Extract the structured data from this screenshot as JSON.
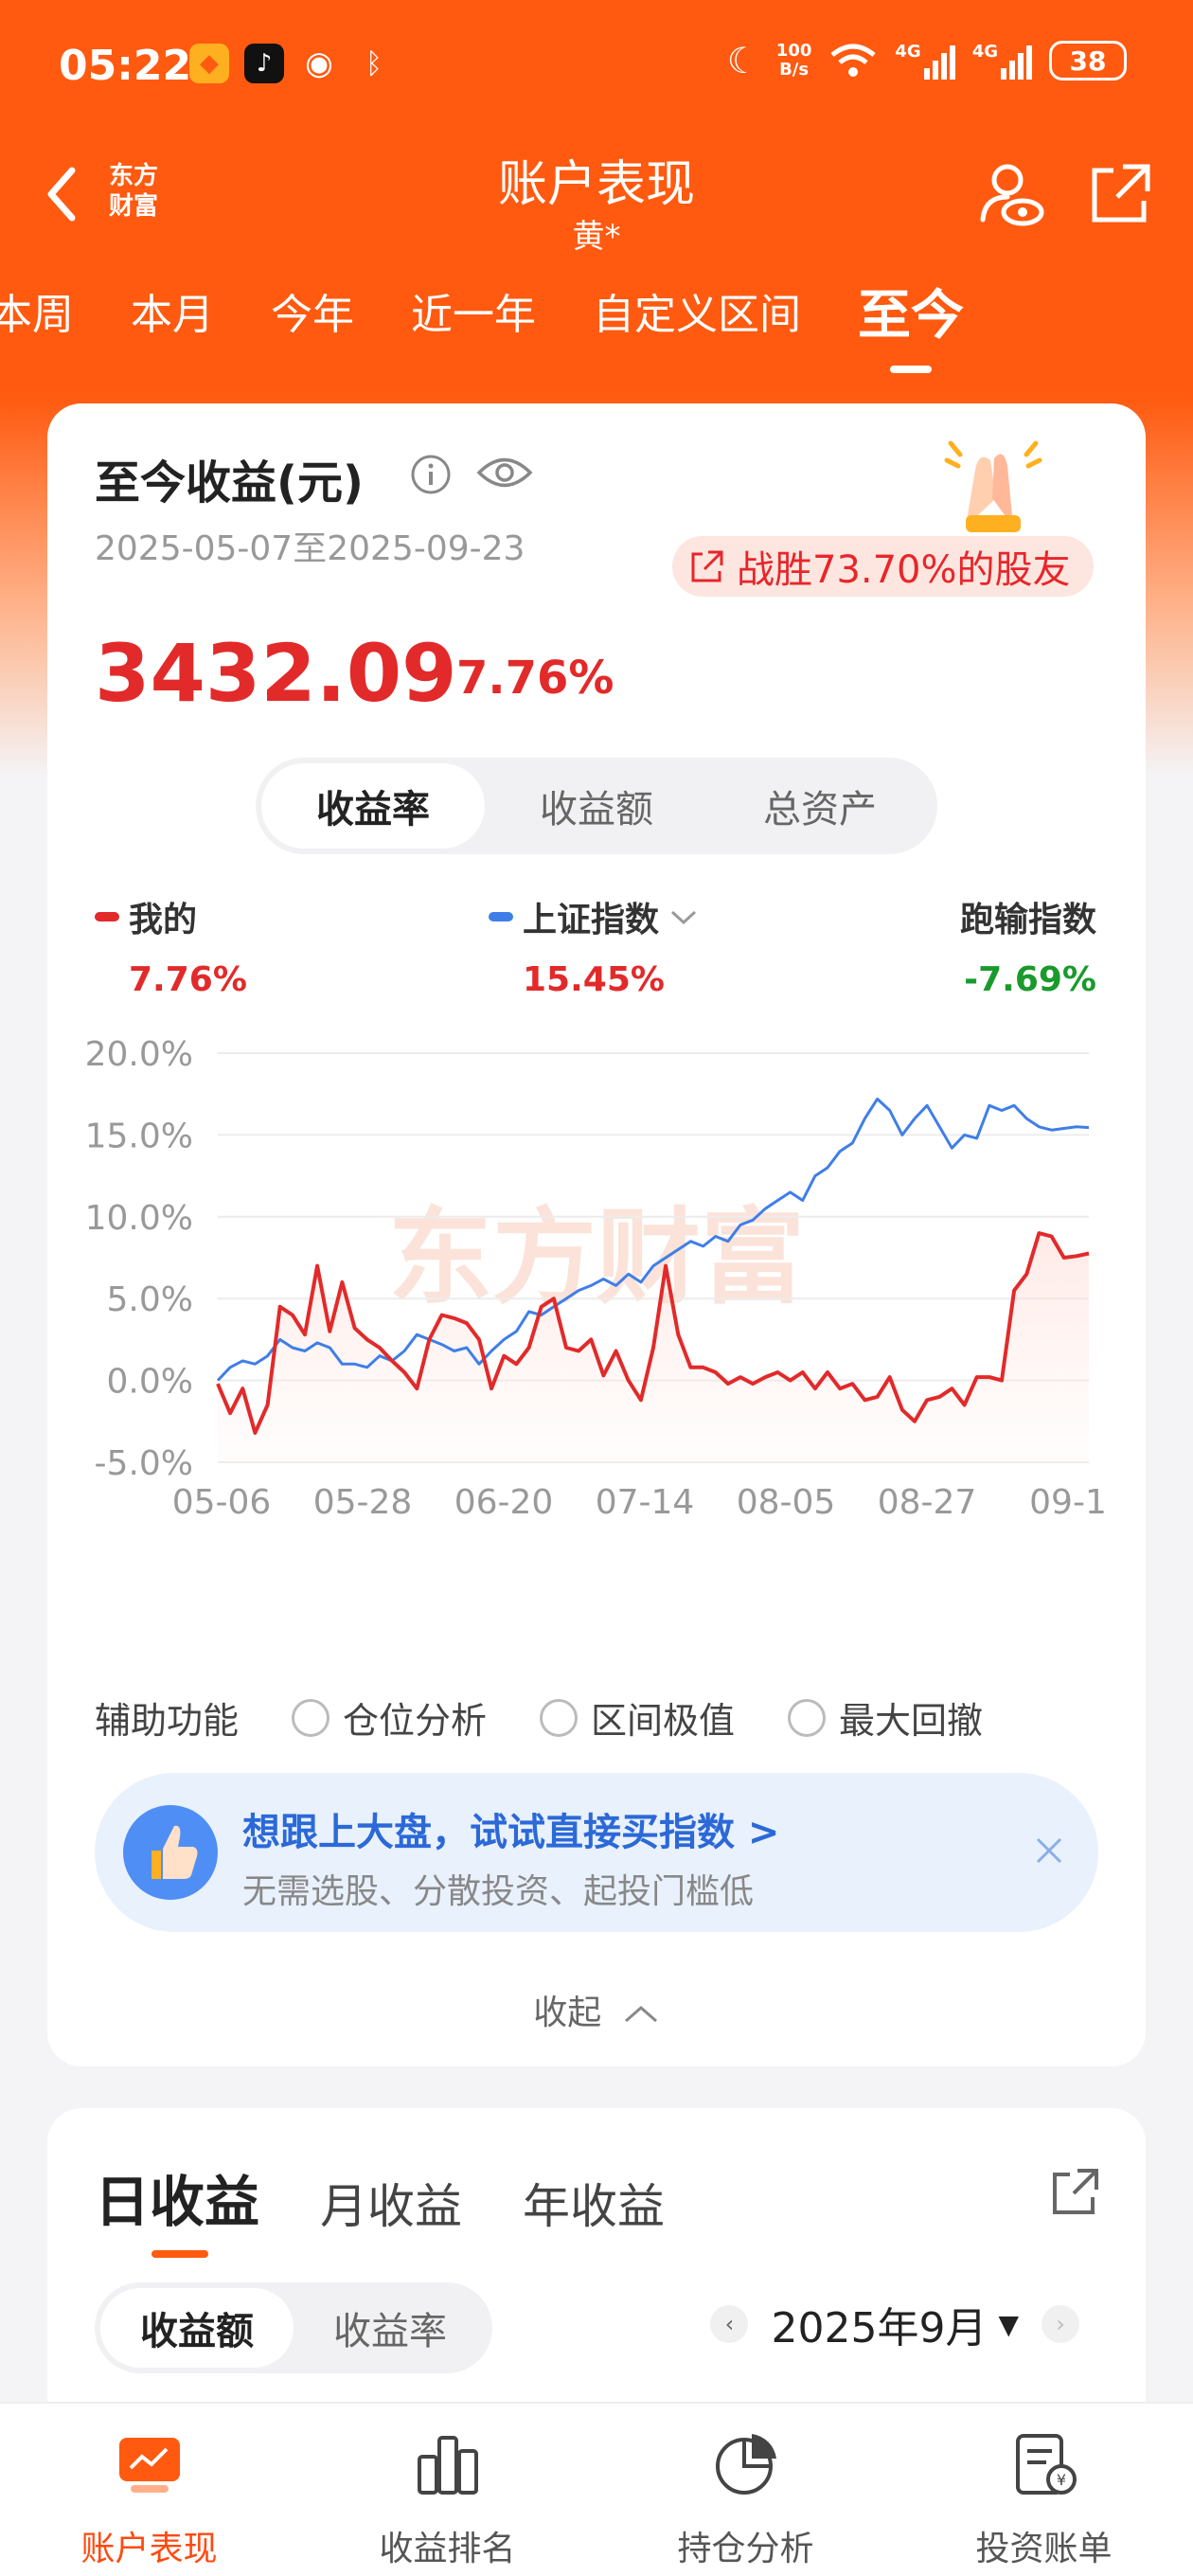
{
  "status_bar": {
    "time": "05:22",
    "net_speed_top": "100",
    "net_speed_bottom": "B/s",
    "signal1": "4G",
    "signal2": "4G",
    "battery": "38"
  },
  "header": {
    "brand_line1": "东方",
    "brand_line2": "财富",
    "title": "账户表现",
    "subtitle": "黄*"
  },
  "period_tabs": [
    "本周",
    "本月",
    "今年",
    "近一年",
    "自定义区间",
    "至今"
  ],
  "summary": {
    "title": "至今收益(元)",
    "date_range": "2025-05-07至2025-09-23",
    "beat_badge": "战胜73.70%的股友",
    "profit": "3432.09",
    "profit_pct": "7.76%"
  },
  "metric_tabs": [
    "收益率",
    "收益额",
    "总资产"
  ],
  "legend": {
    "mine": {
      "label": "我的",
      "value": "7.76%",
      "color": "#e22a2a"
    },
    "index": {
      "label": "上证指数",
      "value": "15.45%",
      "color": "#3f7ee8"
    },
    "beat": {
      "label": "跑输指数",
      "value": "-7.69%",
      "color": "#1a9a2c"
    }
  },
  "watermark": "东方财富",
  "chart_data": {
    "type": "line",
    "x": [
      "05-06",
      "05-08",
      "05-10",
      "05-12",
      "05-14",
      "05-16",
      "05-18",
      "05-20",
      "05-22",
      "05-24",
      "05-26",
      "05-28",
      "05-30",
      "06-01",
      "06-03",
      "06-05",
      "06-07",
      "06-09",
      "06-11",
      "06-13",
      "06-15",
      "06-17",
      "06-20",
      "06-22",
      "06-24",
      "06-26",
      "06-28",
      "06-30",
      "07-02",
      "07-04",
      "07-06",
      "07-08",
      "07-10",
      "07-12",
      "07-14",
      "07-16",
      "07-18",
      "07-20",
      "07-22",
      "07-24",
      "07-26",
      "07-28",
      "07-30",
      "08-01",
      "08-03",
      "08-05",
      "08-07",
      "08-09",
      "08-11",
      "08-13",
      "08-15",
      "08-17",
      "08-19",
      "08-21",
      "08-23",
      "08-25",
      "08-27",
      "08-29",
      "08-31",
      "09-02",
      "09-04",
      "09-06",
      "09-08",
      "09-10",
      "09-12",
      "09-14",
      "09-16",
      "09-18",
      "09-20",
      "09-22",
      "09-23"
    ],
    "series": [
      {
        "name": "我的",
        "values": [
          -0.2,
          -2.0,
          -0.5,
          -3.2,
          -1.5,
          4.5,
          4.0,
          2.8,
          7.0,
          3.0,
          6.0,
          3.2,
          2.5,
          2.0,
          1.2,
          0.5,
          -0.5,
          2.5,
          4.0,
          3.8,
          3.5,
          2.5,
          -0.5,
          1.5,
          1.0,
          2.0,
          4.5,
          5.0,
          2.0,
          1.8,
          2.5,
          0.3,
          1.8,
          0.0,
          -1.2,
          2.0,
          7.0,
          2.8,
          0.8,
          0.8,
          0.5,
          -0.2,
          0.2,
          -0.2,
          0.2,
          0.5,
          0.0,
          0.5,
          -0.5,
          0.5,
          -0.5,
          -0.2,
          -1.2,
          -1.0,
          0.2,
          -1.8,
          -2.5,
          -1.2,
          -1.0,
          -0.5,
          -1.5,
          0.2,
          0.2,
          0.0,
          5.5,
          6.5,
          9.0,
          8.8,
          7.5,
          7.6,
          7.76
        ]
      },
      {
        "name": "上证指数",
        "values": [
          0.0,
          0.8,
          1.2,
          1.0,
          1.5,
          2.5,
          2.0,
          1.8,
          2.3,
          2.0,
          1.0,
          1.0,
          0.8,
          1.5,
          1.2,
          1.8,
          2.8,
          2.5,
          2.2,
          1.8,
          2.0,
          1.0,
          1.8,
          2.5,
          3.0,
          4.2,
          4.0,
          4.5,
          5.0,
          5.5,
          5.8,
          6.2,
          5.8,
          6.5,
          6.0,
          7.0,
          7.5,
          8.0,
          8.5,
          8.2,
          8.8,
          8.5,
          9.5,
          9.8,
          10.5,
          11.0,
          11.5,
          11.0,
          12.5,
          13.0,
          14.0,
          14.5,
          16.0,
          17.2,
          16.5,
          15.0,
          16.0,
          16.8,
          15.5,
          14.2,
          15.0,
          14.8,
          16.8,
          16.5,
          16.8,
          16.0,
          15.5,
          15.3,
          15.4,
          15.5,
          15.45
        ]
      }
    ],
    "xticks": [
      "05-06",
      "05-28",
      "06-20",
      "07-14",
      "08-05",
      "08-27",
      "09-1"
    ],
    "yticks": [
      "20.0%",
      "15.0%",
      "10.0%",
      "5.0%",
      "0.0%",
      "-5.0%"
    ],
    "ylim": [
      -5,
      20
    ],
    "grid": true
  },
  "aux": {
    "label": "辅助功能",
    "options": [
      "仓位分析",
      "区间极值",
      "最大回撤"
    ]
  },
  "promo": {
    "title": "想跟上大盘，试试直接买指数 >",
    "subtitle": "无需选股、分散投资、起投门槛低"
  },
  "collapse_label": "收起",
  "daily": {
    "tabs": [
      "日收益",
      "月收益",
      "年收益"
    ],
    "seg": [
      "收益额",
      "收益率"
    ],
    "month": "2025年9月"
  },
  "bottom_nav": [
    "账户表现",
    "收益排名",
    "持仓分析",
    "投资账单"
  ]
}
